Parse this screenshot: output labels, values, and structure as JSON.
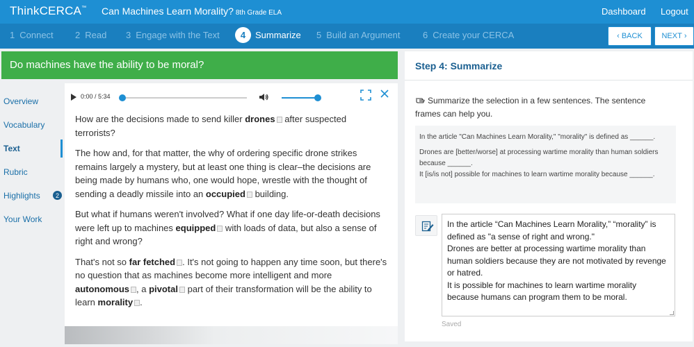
{
  "header": {
    "logo": "ThinkCERCA",
    "logo_mark": "™",
    "lesson_title": "Can Machines Learn Morality?",
    "grade": "8th Grade ELA",
    "dashboard_label": "Dashboard",
    "logout_label": "Logout",
    "colors": {
      "topbar": "#1e8fd3",
      "stepbar": "#1a7fbf",
      "banner": "#3fae49"
    }
  },
  "steps": [
    {
      "num": "1",
      "label": "Connect"
    },
    {
      "num": "2",
      "label": "Read"
    },
    {
      "num": "3",
      "label": "Engage with the Text"
    },
    {
      "num": "4",
      "label": "Summarize"
    },
    {
      "num": "5",
      "label": "Build an Argument"
    },
    {
      "num": "6",
      "label": "Create your CERCA"
    }
  ],
  "nav": {
    "back_label": "BACK",
    "next_label": "NEXT",
    "back_icon": "chevron-left-icon",
    "next_icon": "chevron-right-icon"
  },
  "question": "Do machines have the ability to be moral?",
  "sidebar": {
    "items": [
      {
        "label": "Overview"
      },
      {
        "label": "Vocabulary"
      },
      {
        "label": "Text"
      },
      {
        "label": "Rubric"
      },
      {
        "label": "Highlights"
      },
      {
        "label": "Your Work"
      }
    ],
    "highlights_count": "2"
  },
  "audio": {
    "time": "0:00 / 5:34",
    "progress": 0.0,
    "volume": 1.0
  },
  "article": {
    "p1": {
      "a": "How are the decisions made to send killer ",
      "b": "drones",
      "c": " after suspected terrorists?"
    },
    "p2": {
      "a": "The how and, for that matter, the why of ordering specific drone strikes remains largely a mystery, but at least one thing is clear–the decisions are being made by humans who, one would hope, wrestle with the thought of sending a deadly missile into an ",
      "b": "occupied",
      "c": " building."
    },
    "p3": {
      "a": "But what if humans weren't involved? What if one day life-or-death decisions were left up to machines ",
      "b": "equipped",
      "c": " with loads of data, but also a sense of right and wrong?"
    },
    "p4": {
      "a": "That's not so ",
      "b": "far fetched",
      "c": ". It's not going to happen any time soon, but there's no question that as machines become more intelligent and more ",
      "d": "autonomous",
      "e": ", a ",
      "f": "pivotal",
      "g": " part of their transformation will be the ability to learn ",
      "h": "morality",
      "i": "."
    }
  },
  "summary": {
    "title": "Step 4: Summarize",
    "instructions": "Summarize the selection in a few sentences. The sentence frames can help you.",
    "frames": [
      "In the article \"Can Machines Learn Morality,\" \"morality\" is defined as ______.",
      "Drones are [better/worse] at processing wartime morality than human soldiers because ______.",
      "It [is/is not] possible for machines to learn wartime morality because ______."
    ],
    "answer": "In the article “Can Machines Learn Morality,” “morality” is defined as \"a sense of right and wrong.\"\nDrones are better at processing wartime morality than human soldiers because they are not motivated by revenge or hatred.\nIt is possible for machines to learn wartime morality because humans can program them to be moral.",
    "saved_label": "Saved"
  }
}
